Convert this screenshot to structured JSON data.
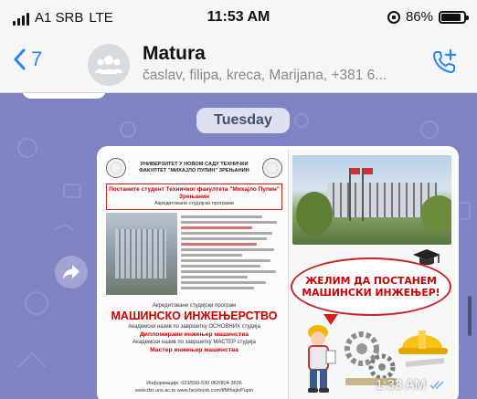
{
  "status_bar": {
    "carrier": "A1 SRB",
    "network": "LTE",
    "time": "11:53 AM",
    "battery_percent": "86%",
    "battery_level": 0.86
  },
  "header": {
    "back_count": "7",
    "chat_name": "Matura",
    "participants": "časlav, filipa, kreca, Marijana, +381 6..."
  },
  "chat": {
    "day_label": "Tuesday",
    "message": {
      "type": "image",
      "time": "1:33 AM",
      "poster": {
        "university": "УНИВЕРЗИТЕТ У НОВОМ САДУ ТЕХНИЧКИ ФАКУЛТЕТ \"МИХАЈЛО ПУПИН\" ЗРЕЊАНИН",
        "headline": "Постаните студент Техничког факултета \"Михајло Пупин\" Зрењанин",
        "subtitle": "Акредитовани студијски програми",
        "program_intro": "Акредитовани студијски програм",
        "program": "МАШИНСКО ИНЖЕЊЕРСТВО",
        "degree_basic": "Академски назив по завршетку ОСНОВНИХ студија",
        "degree_basic_title": "Дипломирани инжењер машинства",
        "degree_master": "Академски назив по завршетку МАСТЕР студија",
        "degree_master_title": "Мастер инжењер машинства",
        "contact": "Информације: 023/550-530   062/804-3606",
        "web": "www.tfzr.uns.ac.rs   www.facebook.com/tfMihajloPupin"
      },
      "speech_line1": "ЖЕЛИМ ДА ПОСТАНЕМ",
      "speech_line2": "МАШИНСКИ ИНЖЕЊЕР!"
    }
  },
  "colors": {
    "chat_bg": "#7f83c4",
    "accent": "#2b83f6",
    "poster_red": "#c00000"
  }
}
